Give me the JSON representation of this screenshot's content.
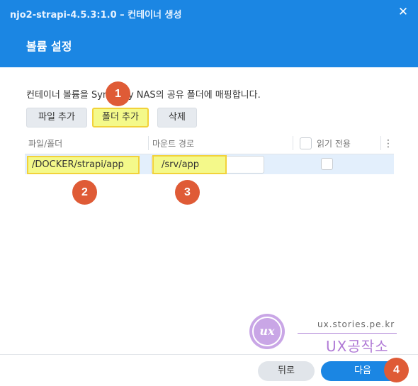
{
  "window": {
    "title": "njo2-strapi-4.5.3:1.0 – 컨테이너 생성",
    "close_glyph": "✕"
  },
  "dialog": {
    "title": "볼륨 설정",
    "description": "컨테이너 볼륨을 Synology NAS의 공유 폴더에 매핑합니다."
  },
  "toolbar": {
    "add_file_label": "파일 추가",
    "add_folder_label": "폴더 추가",
    "delete_label": "삭제"
  },
  "table": {
    "columns": [
      "파일/폴더",
      "마운트 경로",
      "읽기 전용"
    ],
    "menu_glyph": "⋮",
    "rows": [
      {
        "path": "/DOCKER/strapi/app",
        "mount": "/srv/app",
        "read_only": false
      }
    ]
  },
  "markers": [
    "1",
    "2",
    "3",
    "4"
  ],
  "watermark": {
    "logo_text": "ux",
    "url": "ux.stories.pe.kr",
    "brand": "UX공작소"
  },
  "footer": {
    "back_label": "뒤로",
    "next_label": "다음"
  },
  "colors": {
    "primary": "#1b86e3",
    "highlight": "#f4f98a",
    "highlight_border": "#f2d23a",
    "marker": "#df5b36",
    "watermark": "#b07ad6"
  }
}
